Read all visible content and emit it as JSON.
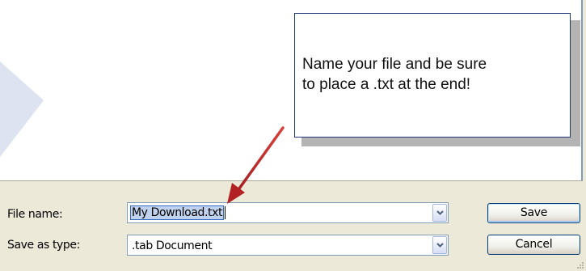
{
  "callout": {
    "text": "Name your file and be sure\nto place a .txt at the end!"
  },
  "form": {
    "file_name_label": "File name:",
    "file_name_value": "My Download.txt",
    "save_as_type_label": "Save as type:",
    "save_as_type_value": ".tab Document"
  },
  "buttons": {
    "save": "Save",
    "cancel": "Cancel"
  },
  "icons": {
    "dropdown": "chevron-down-icon",
    "resize": "resize-grip-icon",
    "pointer": "red-arrow-icon"
  },
  "colors": {
    "annotation_arrow": "#c0282a",
    "callout_border": "#1f3a7a",
    "dialog_background": "#ece9d8"
  }
}
